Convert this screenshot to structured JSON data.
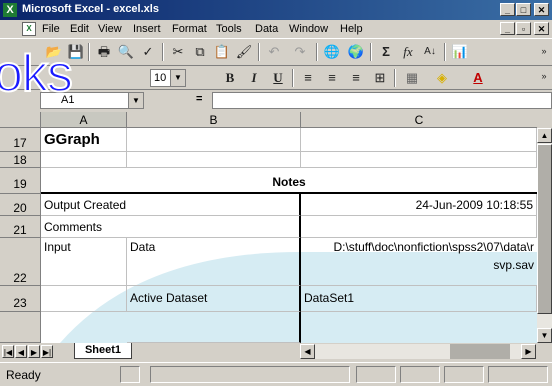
{
  "window": {
    "title": "Microsoft Excel - excel.xls",
    "app_icon": "excel-icon"
  },
  "menu": [
    "File",
    "Edit",
    "View",
    "Insert",
    "Format",
    "Tools",
    "Data",
    "Window",
    "Help"
  ],
  "toolbar": {
    "font_size": "10",
    "overlay_text": "oks"
  },
  "formula_bar": {
    "cell_ref": "A1",
    "fx": "="
  },
  "columns": [
    "A",
    "B",
    "C"
  ],
  "rows": [
    {
      "num": "17",
      "a": "GGraph",
      "b": "",
      "c": ""
    },
    {
      "num": "18",
      "a": "",
      "b": "",
      "c": ""
    },
    {
      "num": "19",
      "notes": "Notes"
    },
    {
      "num": "20",
      "a": "Output Created",
      "b": "",
      "c": "24-Jun-2009 10:18:55"
    },
    {
      "num": "21",
      "a": "Comments",
      "b": "",
      "c": ""
    },
    {
      "num": "22",
      "a": "Input",
      "b": "Data",
      "c": "D:\\stuff\\doc\\nonfiction\\spss2\\07\\data\\r",
      "c2": "svp.sav"
    },
    {
      "num": "23",
      "a": "",
      "b": "Active Dataset",
      "c": "DataSet1"
    }
  ],
  "sheet_tab": "Sheet1",
  "status": "Ready",
  "colors": {
    "title_start": "#0a246a",
    "title_end": "#3a6ea5",
    "overlay": "#1a1aff",
    "table_tint": "#d6ecf3"
  }
}
